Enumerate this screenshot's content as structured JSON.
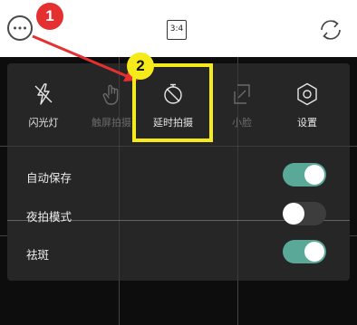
{
  "topbar": {
    "more_icon": "more-horizontal-icon",
    "aspect_ratio": "3:4",
    "switch_icon": "switch-camera-icon"
  },
  "tools": [
    {
      "label": "闪光灯",
      "icon": "flash-off-icon",
      "enabled": true
    },
    {
      "label": "触屏拍摄",
      "icon": "touch-hand-icon",
      "enabled": false
    },
    {
      "label": "延时拍摄",
      "icon": "timer-off-icon",
      "enabled": true
    },
    {
      "label": "小脸",
      "icon": "slim-face-icon",
      "enabled": false
    },
    {
      "label": "设置",
      "icon": "settings-gear-icon",
      "enabled": true
    }
  ],
  "toggles": [
    {
      "label": "自动保存",
      "state": "on"
    },
    {
      "label": "夜拍模式",
      "state": "off"
    },
    {
      "label": "祛斑",
      "state": "on"
    }
  ],
  "annotations": {
    "step1": "1",
    "step2": "2",
    "accent_red": "#e43030",
    "accent_yellow": "#f5ea1a",
    "toggle_on_color": "#5aa898"
  }
}
